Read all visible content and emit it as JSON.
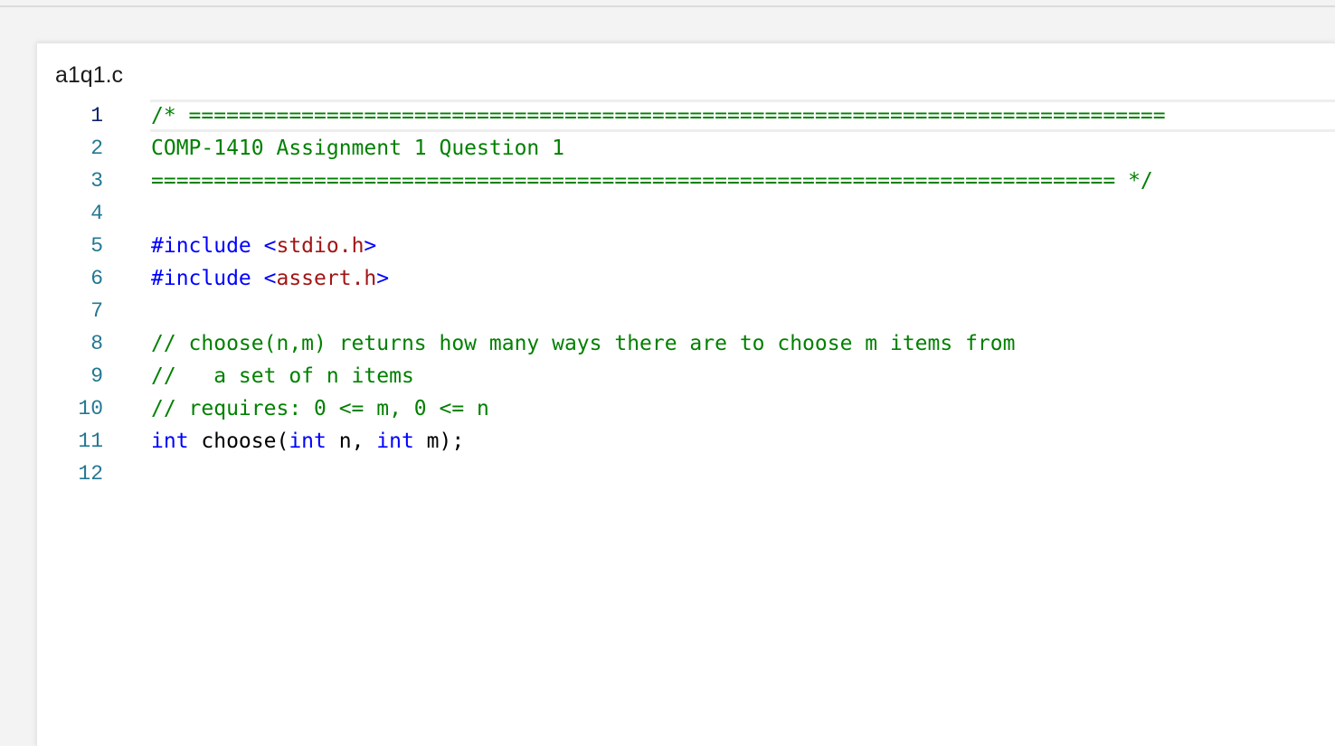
{
  "editor": {
    "file_name": "a1q1.c",
    "active_line": 1,
    "colors": {
      "comment": "#008000",
      "keyword": "#0000ff",
      "string": "#a31515",
      "line_number": "#237893"
    },
    "lines": [
      {
        "number": "1",
        "tokens": [
          {
            "type": "comment",
            "text": "/* =============================================================================="
          }
        ]
      },
      {
        "number": "2",
        "tokens": [
          {
            "type": "comment",
            "text": "COMP-1410 Assignment 1 Question 1"
          }
        ]
      },
      {
        "number": "3",
        "tokens": [
          {
            "type": "comment",
            "text": "============================================================================= */"
          }
        ]
      },
      {
        "number": "4",
        "tokens": []
      },
      {
        "number": "5",
        "tokens": [
          {
            "type": "keyword",
            "text": "#include <"
          },
          {
            "type": "string",
            "text": "stdio.h"
          },
          {
            "type": "keyword",
            "text": ">"
          }
        ]
      },
      {
        "number": "6",
        "tokens": [
          {
            "type": "keyword",
            "text": "#include <"
          },
          {
            "type": "string",
            "text": "assert.h"
          },
          {
            "type": "keyword",
            "text": ">"
          }
        ]
      },
      {
        "number": "7",
        "tokens": []
      },
      {
        "number": "8",
        "tokens": [
          {
            "type": "comment",
            "text": "// choose(n,m) returns how many ways there are to choose m items from"
          }
        ]
      },
      {
        "number": "9",
        "tokens": [
          {
            "type": "comment",
            "text": "//   a set of n items"
          }
        ]
      },
      {
        "number": "10",
        "tokens": [
          {
            "type": "comment",
            "text": "// requires: 0 <= m, 0 <= n"
          }
        ]
      },
      {
        "number": "11",
        "tokens": [
          {
            "type": "keyword",
            "text": "int"
          },
          {
            "type": "plain",
            "text": " choose("
          },
          {
            "type": "keyword",
            "text": "int"
          },
          {
            "type": "plain",
            "text": " n, "
          },
          {
            "type": "keyword",
            "text": "int"
          },
          {
            "type": "plain",
            "text": " m);"
          }
        ]
      },
      {
        "number": "12",
        "tokens": []
      }
    ]
  }
}
